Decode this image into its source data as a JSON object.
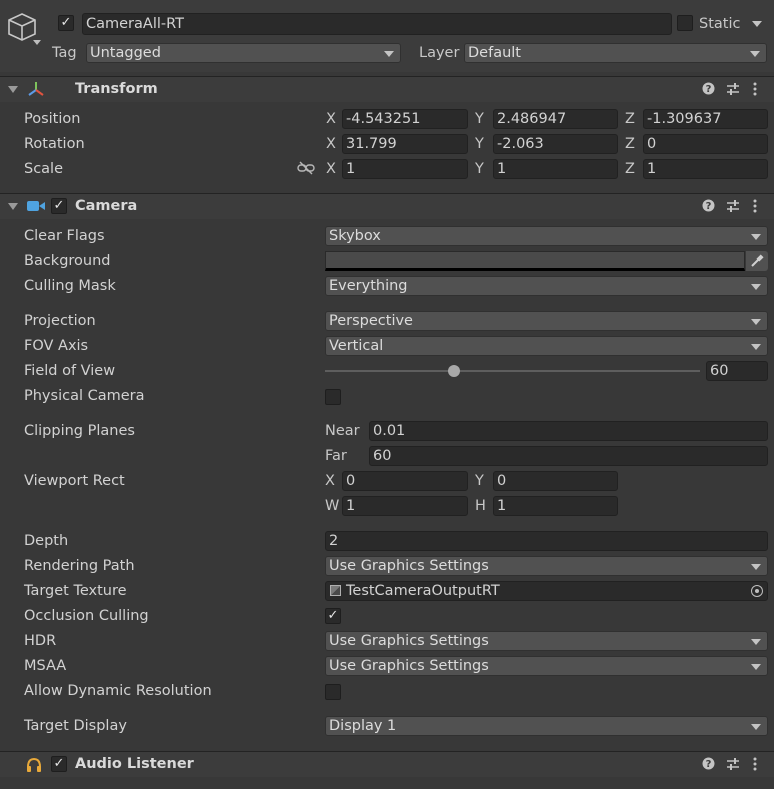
{
  "object": {
    "name": "CameraAll-RT",
    "active": true,
    "static_label": "Static",
    "tag_label": "Tag",
    "tag_value": "Untagged",
    "layer_label": "Layer",
    "layer_value": "Default"
  },
  "transform": {
    "title": "Transform",
    "rows": [
      {
        "label": "Position",
        "x": "-4.543251",
        "y": "2.486947",
        "z": "-1.309637"
      },
      {
        "label": "Rotation",
        "x": "31.799",
        "y": "-2.063",
        "z": "0"
      },
      {
        "label": "Scale",
        "x": "1",
        "y": "1",
        "z": "1"
      }
    ],
    "axis_x": "X",
    "axis_y": "Y",
    "axis_z": "Z"
  },
  "camera": {
    "title": "Camera",
    "enabled": true,
    "clear_flags": {
      "label": "Clear Flags",
      "value": "Skybox"
    },
    "background": {
      "label": "Background",
      "color": "#4a4a4a"
    },
    "culling_mask": {
      "label": "Culling Mask",
      "value": "Everything"
    },
    "projection": {
      "label": "Projection",
      "value": "Perspective"
    },
    "fov_axis": {
      "label": "FOV Axis",
      "value": "Vertical"
    },
    "field_of_view": {
      "label": "Field of View",
      "value": "60",
      "slider_fraction": 0.344
    },
    "physical_camera": {
      "label": "Physical Camera",
      "checked": false
    },
    "clipping": {
      "label": "Clipping Planes",
      "near_label": "Near",
      "near": "0.01",
      "far_label": "Far",
      "far": "60"
    },
    "viewport": {
      "label": "Viewport Rect",
      "x_label": "X",
      "x": "0",
      "y_label": "Y",
      "y": "0",
      "w_label": "W",
      "w": "1",
      "h_label": "H",
      "h": "1"
    },
    "depth": {
      "label": "Depth",
      "value": "2"
    },
    "rendering_path": {
      "label": "Rendering Path",
      "value": "Use Graphics Settings"
    },
    "target_texture": {
      "label": "Target Texture",
      "value": "TestCameraOutputRT"
    },
    "occlusion_culling": {
      "label": "Occlusion Culling",
      "checked": true
    },
    "hdr": {
      "label": "HDR",
      "value": "Use Graphics Settings"
    },
    "msaa": {
      "label": "MSAA",
      "value": "Use Graphics Settings"
    },
    "dynamic_resolution": {
      "label": "Allow Dynamic Resolution",
      "checked": false
    },
    "target_display": {
      "label": "Target Display",
      "value": "Display 1"
    }
  },
  "audio_listener": {
    "title": "Audio Listener",
    "enabled": true
  },
  "icons": {
    "gameobject": "cube-icon",
    "transform": "transform-axes-icon",
    "camera": "camera-icon",
    "audio": "headphones-icon",
    "help": "help-icon",
    "presets": "preset-sliders-icon",
    "menu": "kebab-menu-icon",
    "constrain": "link-broken-icon",
    "picker": "eyedropper-icon",
    "object_picker": "target-picker-icon"
  },
  "colors": {
    "panel": "#383838",
    "field": "#2a2a2a",
    "dropdown": "#515151"
  }
}
